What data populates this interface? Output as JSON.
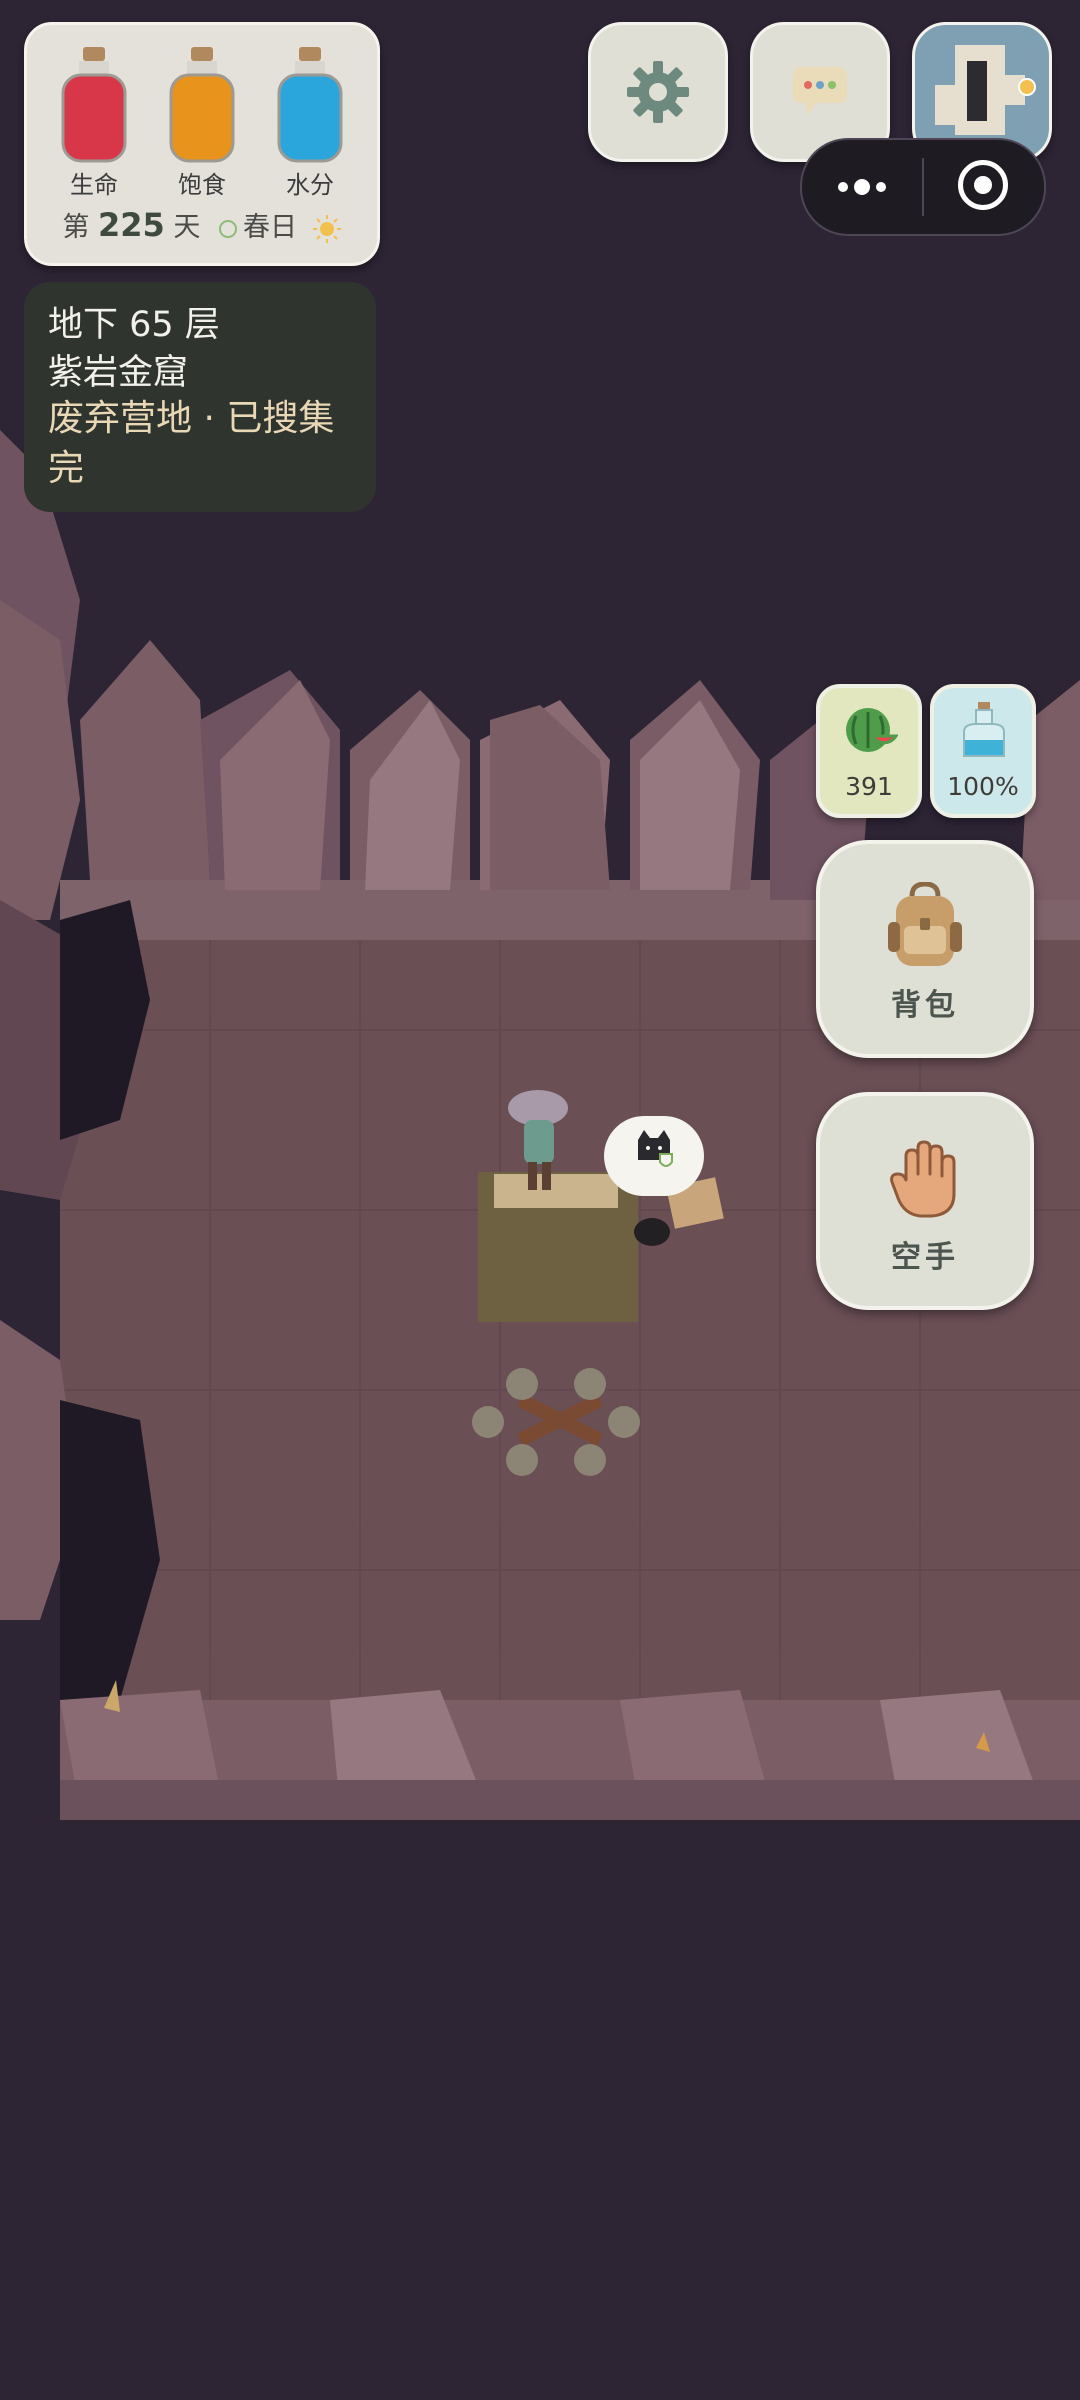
{
  "stats": {
    "items": [
      {
        "label": "生命",
        "color": "#d8374a",
        "icon": "red-potion-icon"
      },
      {
        "label": "饱食",
        "color": "#e8931c",
        "icon": "orange-potion-icon"
      },
      {
        "label": "水分",
        "color": "#2aa6dc",
        "icon": "blue-potion-icon"
      }
    ],
    "day_prefix": "第",
    "day_number": "225",
    "day_suffix": "天",
    "season": "春日"
  },
  "location": {
    "floor": "地下 65 层",
    "area": "紫岩金窟",
    "status": "废弃营地 · 已搜集完"
  },
  "toolbar": {
    "settings_icon": "gear-icon",
    "chat_icon": "chat-bubble-icon",
    "map_icon": "minimap-icon",
    "menu_icon": "more-dots-icon",
    "close_icon": "target-circle-icon"
  },
  "resources": {
    "food_value": "391",
    "water_value": "100%"
  },
  "actions": {
    "backpack_label": "背包",
    "hand_label": "空手"
  }
}
